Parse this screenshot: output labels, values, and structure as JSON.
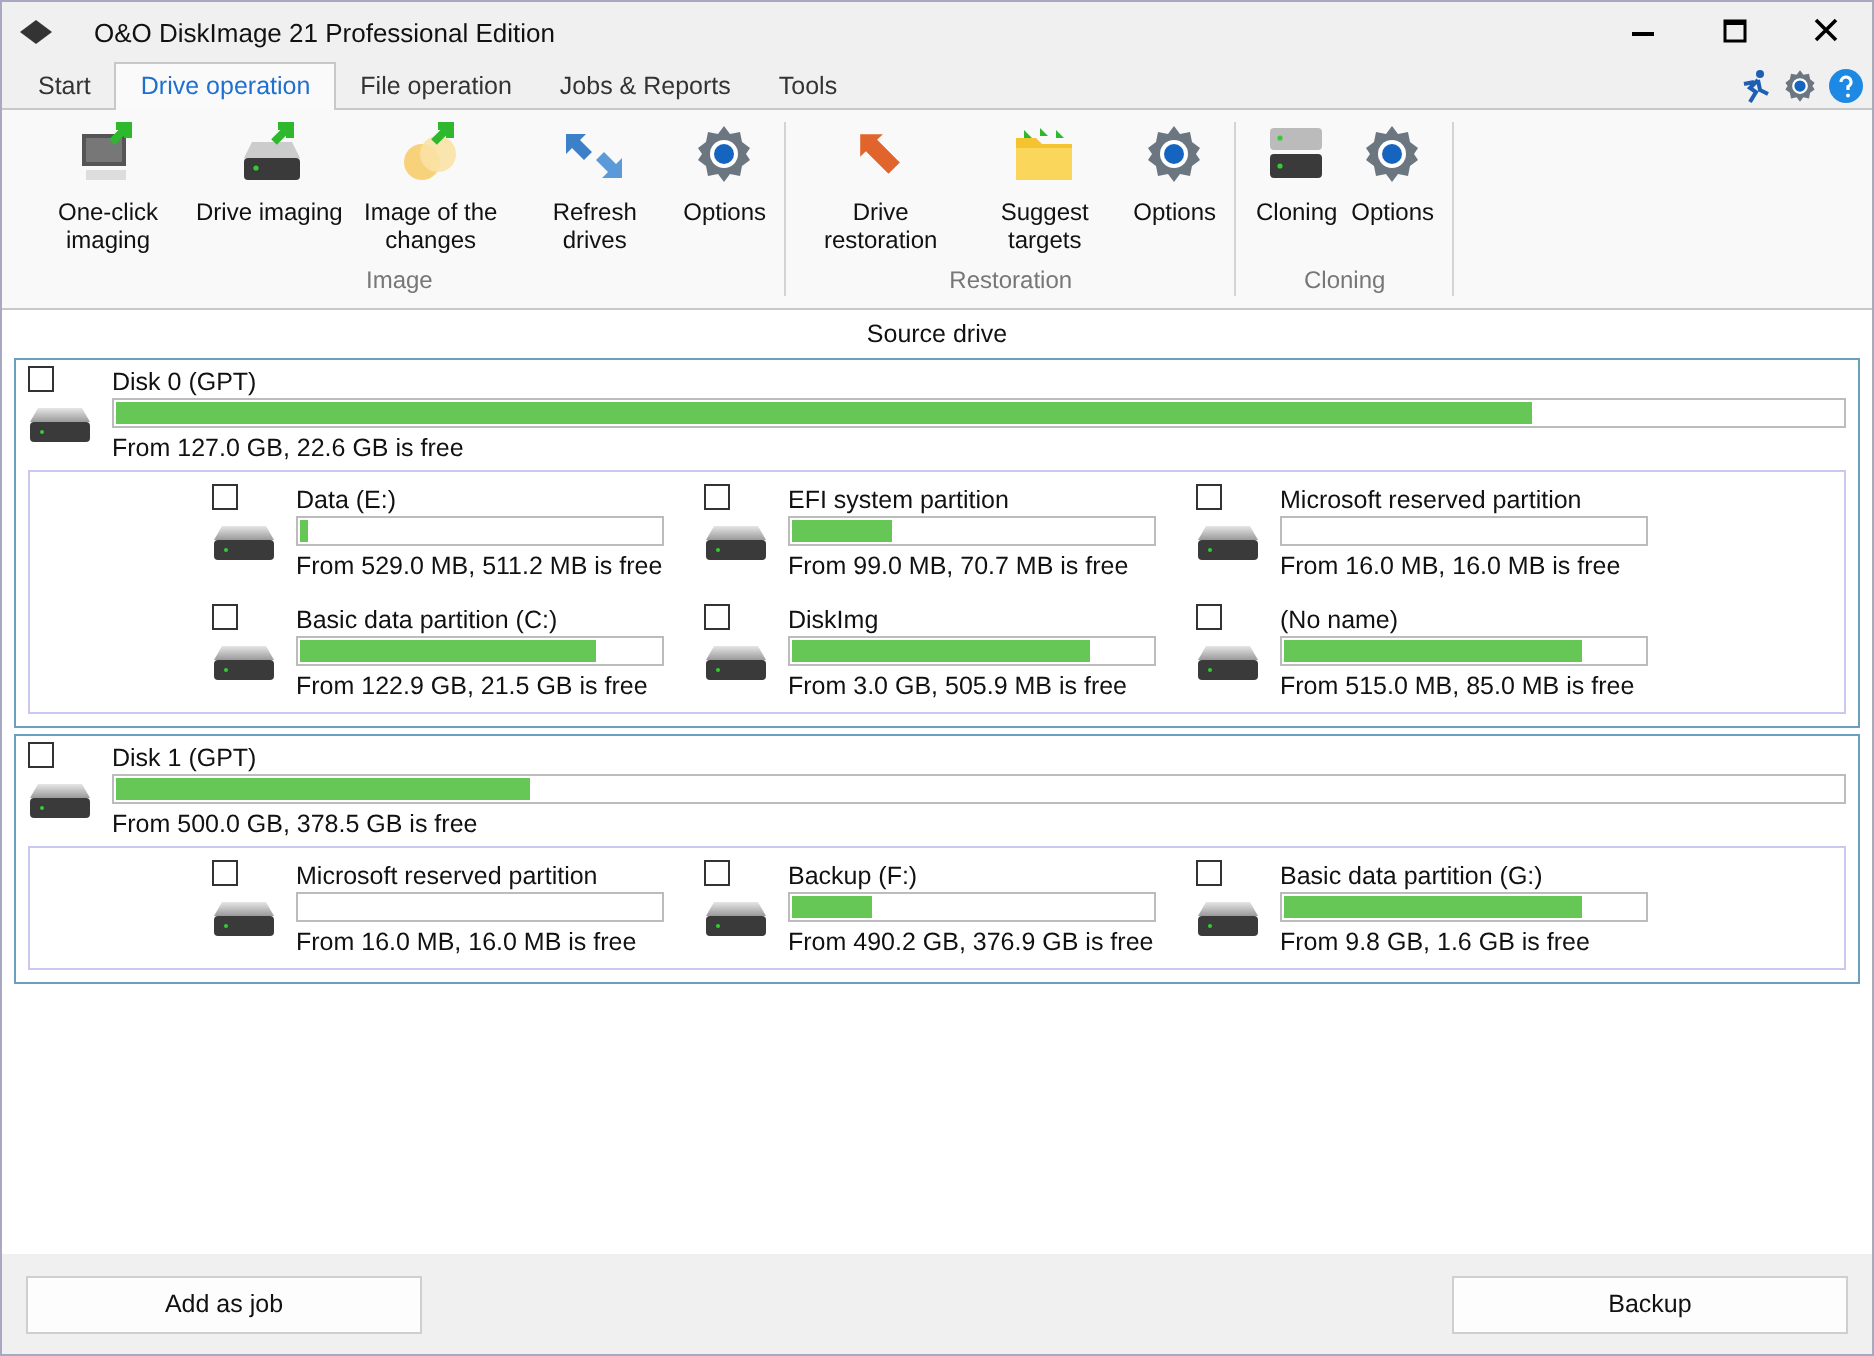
{
  "window": {
    "title": "O&O DiskImage 21 Professional Edition"
  },
  "tabs": [
    {
      "label": "Start",
      "selected": false
    },
    {
      "label": "Drive operation",
      "selected": true
    },
    {
      "label": "File operation",
      "selected": false
    },
    {
      "label": "Jobs & Reports",
      "selected": false
    },
    {
      "label": "Tools",
      "selected": false
    }
  ],
  "ribbon": {
    "groups": [
      {
        "label": "Image",
        "buttons": [
          {
            "kind": "monitor",
            "label": "One-click imaging"
          },
          {
            "kind": "drive",
            "label": "Drive imaging"
          },
          {
            "kind": "changes",
            "label": "Image of the changes"
          },
          {
            "kind": "refresh",
            "label": "Refresh drives"
          },
          {
            "kind": "gear",
            "label": "Options"
          }
        ]
      },
      {
        "label": "Restoration",
        "buttons": [
          {
            "kind": "restore",
            "label": "Drive restoration"
          },
          {
            "kind": "folder",
            "label": "Suggest targets"
          },
          {
            "kind": "gear",
            "label": "Options"
          }
        ]
      },
      {
        "label": "Cloning",
        "buttons": [
          {
            "kind": "clone",
            "label": "Cloning"
          },
          {
            "kind": "gear",
            "label": "Options"
          }
        ]
      }
    ]
  },
  "section_title": "Source drive",
  "disks": [
    {
      "name": "Disk 0 (GPT)",
      "checked": false,
      "level": 0.82,
      "info": "From 127.0 GB, 22.6 GB is free",
      "partitions": [
        {
          "name": "Data (E:)",
          "checked": false,
          "level": 0.02,
          "info": "From 529.0 MB, 511.2 MB is free"
        },
        {
          "name": "EFI system partition",
          "checked": false,
          "level": 0.28,
          "info": "From 99.0 MB, 70.7 MB is free"
        },
        {
          "name": "Microsoft reserved partition",
          "checked": false,
          "level": 0,
          "info": "From 16.0 MB, 16.0 MB is free"
        },
        {
          "name": "Basic data partition (C:)",
          "checked": false,
          "level": 0.82,
          "info": "From 122.9 GB, 21.5 GB is free"
        },
        {
          "name": "DiskImg",
          "checked": false,
          "level": 0.83,
          "info": "From 3.0 GB, 505.9 MB is free"
        },
        {
          "name": "(No name)",
          "checked": false,
          "level": 0.83,
          "info": "From 515.0 MB, 85.0 MB is free"
        }
      ]
    },
    {
      "name": "Disk 1 (GPT)",
      "checked": false,
      "level": 0.24,
      "info": "From 500.0 GB, 378.5 GB is free",
      "partitions": [
        {
          "name": "Microsoft reserved partition",
          "checked": false,
          "level": 0,
          "info": "From 16.0 MB, 16.0 MB is free"
        },
        {
          "name": "Backup (F:)",
          "checked": false,
          "level": 0.22,
          "info": "From 490.2 GB, 376.9 GB is free"
        },
        {
          "name": "Basic data partition (G:)",
          "checked": false,
          "level": 0.83,
          "info": "From 9.8 GB, 1.6 GB is free"
        }
      ]
    }
  ],
  "buttons": [
    {
      "label": "Add as job"
    },
    {
      "label": "Backup"
    }
  ]
}
